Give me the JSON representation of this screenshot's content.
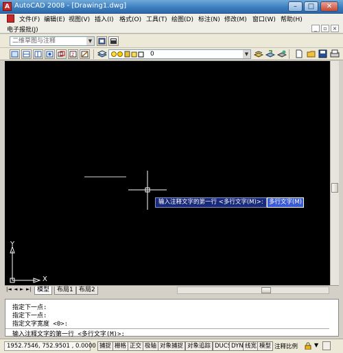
{
  "window": {
    "title": "AutoCAD 2008 - [Drawing1.dwg]",
    "app_icon_glyph": "A",
    "minimize_glyph": "–",
    "maximize_glyph": "□",
    "close_glyph": "✕"
  },
  "menu": {
    "items": [
      "文件(F)",
      "编辑(E)",
      "视图(V)",
      "插入(I)",
      "格式(O)",
      "工具(T)",
      "绘图(D)",
      "标注(N)",
      "修改(M)",
      "窗口(W)",
      "帮助(H)"
    ],
    "second_row_label": "电子报批(J)",
    "doc_minimize_glyph": "_",
    "doc_restore_glyph": "▫",
    "doc_close_glyph": "×"
  },
  "toolbar": {
    "workspace_value": "二维草图与注释",
    "layer_value": "0",
    "combo_arrow_glyph": "▼"
  },
  "drawing": {
    "ucs_y_label": "Y",
    "ucs_x_label": "X",
    "mtext_prompt": "输入注释文字的第一行 <多行文字(M)>:",
    "mtext_input": "多行文字(M)"
  },
  "tabs": {
    "nav_glyphs": [
      "|◄",
      "◄",
      "►",
      "►|"
    ],
    "items": [
      "模型",
      "布局1",
      "布局2"
    ]
  },
  "command": {
    "history": [
      "指定下一点:",
      "指定下一点:",
      "指定文字宽度 <0>:"
    ],
    "current": "输入注释文字的第一行 <多行文字(M)>:"
  },
  "status": {
    "coordinates": "1952.7546, 752.9501 , 0.0000",
    "toggles": [
      "捕捉",
      "栅格",
      "正交",
      "极轴",
      "对象捕捉",
      "对象追踪",
      "DUCS",
      "DYN",
      "线宽",
      "模型"
    ],
    "annotation_scale": "注释比例"
  },
  "colors": {
    "canvas_background": "#000000",
    "title_bar": "#3d7fc0",
    "tooltip_background": "#1a2a7a",
    "input_background": "#3a5bd6"
  }
}
